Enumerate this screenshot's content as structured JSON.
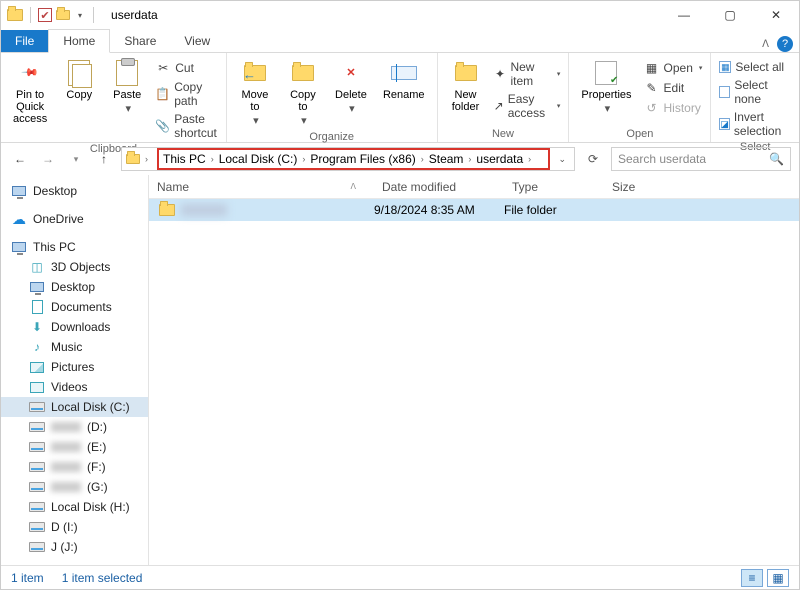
{
  "title": "userdata",
  "tabs": {
    "file": "File",
    "home": "Home",
    "share": "Share",
    "view": "View"
  },
  "ribbon": {
    "clipboard": {
      "label": "Clipboard",
      "pin": "Pin to Quick\naccess",
      "copy": "Copy",
      "paste": "Paste",
      "cut": "Cut",
      "copypath": "Copy path",
      "pasteshort": "Paste shortcut"
    },
    "organize": {
      "label": "Organize",
      "moveto": "Move\nto",
      "copyto": "Copy\nto",
      "delete": "Delete",
      "rename": "Rename"
    },
    "new": {
      "label": "New",
      "newfolder": "New\nfolder",
      "newitem": "New item",
      "easyaccess": "Easy access"
    },
    "open": {
      "label": "Open",
      "properties": "Properties",
      "open": "Open",
      "edit": "Edit",
      "history": "History"
    },
    "select": {
      "label": "Select",
      "selectall": "Select all",
      "selectnone": "Select none",
      "invert": "Invert selection"
    }
  },
  "breadcrumb": {
    "segments": [
      "This PC",
      "Local Disk (C:)",
      "Program Files (x86)",
      "Steam",
      "userdata"
    ]
  },
  "search": {
    "placeholder": "Search userdata"
  },
  "sidebar": {
    "desktop": "Desktop",
    "onedrive": "OneDrive",
    "thispc": "This PC",
    "objects3d": "3D Objects",
    "desktop2": "Desktop",
    "documents": "Documents",
    "downloads": "Downloads",
    "music": "Music",
    "pictures": "Pictures",
    "videos": "Videos",
    "localc": "Local Disk (C:)",
    "drive_d": "(D:)",
    "drive_e": "(E:)",
    "drive_f": "(F:)",
    "drive_g": "(G:)",
    "drive_h": "Local Disk (H:)",
    "drive_i": "D (I:)",
    "drive_j": "J (J:)"
  },
  "columns": {
    "name": "Name",
    "date": "Date modified",
    "type": "Type",
    "size": "Size"
  },
  "rows": [
    {
      "date": "9/18/2024 8:35 AM",
      "type": "File folder",
      "size": ""
    }
  ],
  "status": {
    "count": "1 item",
    "selected": "1 item selected"
  }
}
